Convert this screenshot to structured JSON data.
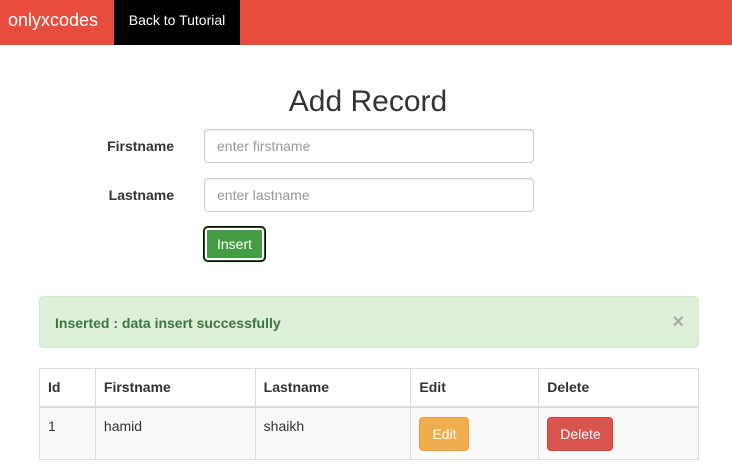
{
  "navbar": {
    "brand": "onlyxcodes",
    "link": "Back to Tutorial"
  },
  "form": {
    "title": "Add Record",
    "firstname_label": "Firstname",
    "firstname_placeholder": "enter firstname",
    "lastname_label": "Lastname",
    "lastname_placeholder": "enter lastname",
    "submit_label": "Insert"
  },
  "alert": {
    "message": "Inserted : data insert successfully",
    "close": "×"
  },
  "table": {
    "headers": [
      "Id",
      "Firstname",
      "Lastname",
      "Edit",
      "Delete"
    ],
    "rows": [
      {
        "id": "1",
        "firstname": "hamid",
        "lastname": "shaikh",
        "edit_label": "Edit",
        "delete_label": "Delete"
      }
    ]
  }
}
